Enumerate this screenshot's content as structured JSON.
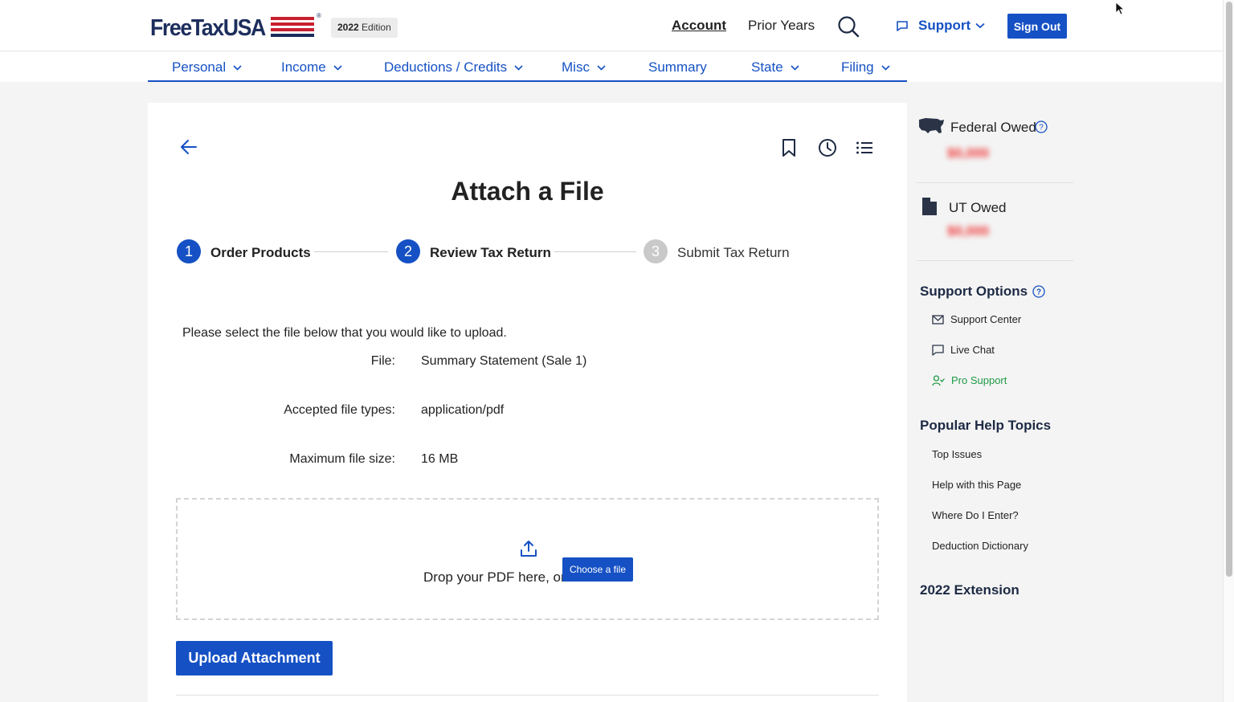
{
  "header": {
    "logo_text": "FreeTaxUSA",
    "logo_reg": "®",
    "edition_year": "2022",
    "edition_label": "Edition",
    "account_link": "Account",
    "prior_years_link": "Prior Years",
    "support_label": "Support",
    "sign_out_label": "Sign Out",
    "accent_color": "#1551c4"
  },
  "nav": {
    "items": [
      {
        "label": "Personal",
        "has_dropdown": true
      },
      {
        "label": "Income",
        "has_dropdown": true
      },
      {
        "label": "Deductions / Credits",
        "has_dropdown": true
      },
      {
        "label": "Misc",
        "has_dropdown": true
      },
      {
        "label": "Summary",
        "has_dropdown": false
      },
      {
        "label": "State",
        "has_dropdown": true
      },
      {
        "label": "Filing",
        "has_dropdown": true
      }
    ]
  },
  "main": {
    "title": "Attach a File",
    "steps": [
      {
        "number": "1",
        "label": "Order Products",
        "state": "active"
      },
      {
        "number": "2",
        "label": "Review Tax Return",
        "state": "active"
      },
      {
        "number": "3",
        "label": "Submit Tax Return",
        "state": "future"
      }
    ],
    "intro": "Please select the file below that you would like to upload.",
    "file_label": "File:",
    "file_value": "Summary Statement (Sale 1)",
    "types_label": "Accepted file types:",
    "types_value": "application/pdf",
    "size_label": "Maximum file size:",
    "size_value": "16 MB",
    "drop_text": "Drop your PDF here, or",
    "choose_label": "Choose a file",
    "upload_label": "Upload Attachment"
  },
  "sidebar": {
    "federal_label": "Federal Owed",
    "federal_amount": "$0,000",
    "state_label": "UT Owed",
    "state_amount": "$0,000",
    "support_heading": "Support Options",
    "support_links": [
      {
        "label": "Support Center",
        "icon": "mail-icon"
      },
      {
        "label": "Live Chat",
        "icon": "chat-icon"
      },
      {
        "label": "Pro Support",
        "icon": "user-check-icon"
      }
    ],
    "help_heading": "Popular Help Topics",
    "help_links": [
      "Top Issues",
      "Help with this Page",
      "Where Do I Enter?",
      "Deduction Dictionary"
    ],
    "extension_heading": "2022 Extension"
  }
}
